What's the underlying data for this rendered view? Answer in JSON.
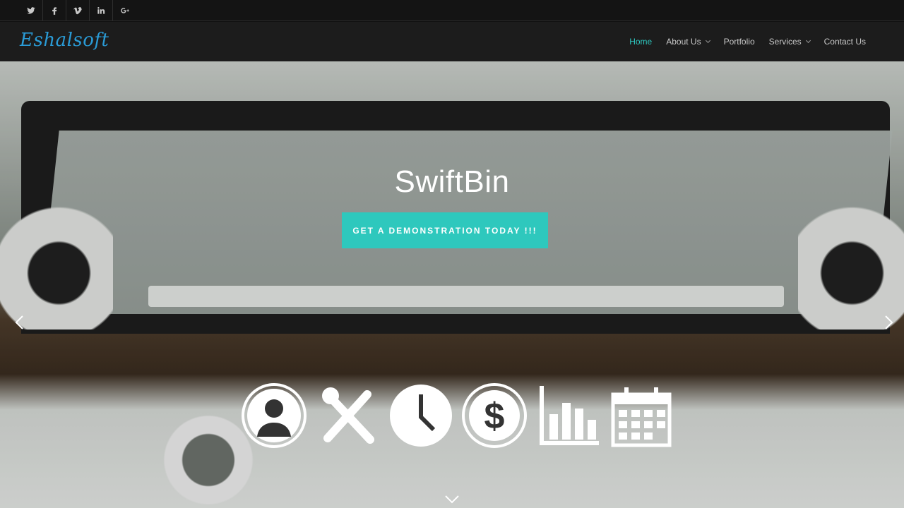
{
  "social": {
    "items": [
      {
        "name": "twitter-icon",
        "glyph": "t"
      },
      {
        "name": "facebook-icon",
        "glyph": "f"
      },
      {
        "name": "vimeo-icon",
        "glyph": "v"
      },
      {
        "name": "linkedin-icon",
        "glyph": "in"
      },
      {
        "name": "google-plus-icon",
        "glyph": "g+"
      }
    ]
  },
  "brand": {
    "logo_text": "Eshalsoft",
    "logo_color": "#2a9bd6"
  },
  "nav": {
    "items": [
      {
        "label": "Home",
        "active": true,
        "has_dropdown": false
      },
      {
        "label": "About Us",
        "active": false,
        "has_dropdown": true
      },
      {
        "label": "Portfolio",
        "active": false,
        "has_dropdown": false
      },
      {
        "label": "Services",
        "active": false,
        "has_dropdown": true
      },
      {
        "label": "Contact Us",
        "active": false,
        "has_dropdown": false
      }
    ],
    "active_color": "#2ec8c0"
  },
  "hero": {
    "title": "SwiftBin",
    "cta_label": "GET A DEMONSTRATION TODAY !!!",
    "cta_color": "#2ec8bd",
    "feature_icons": [
      "user-icon",
      "tools-icon",
      "clock-icon",
      "dollar-icon",
      "bar-chart-icon",
      "calendar-icon"
    ]
  }
}
